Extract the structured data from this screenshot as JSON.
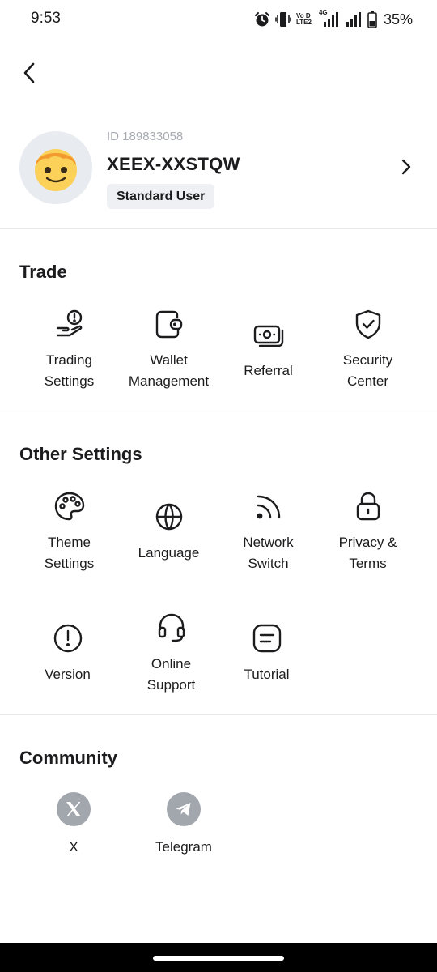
{
  "status_bar": {
    "time": "9:53",
    "battery": "35%",
    "network_tag": "4G",
    "volte_line1": "Vo D",
    "volte_line2": "LTE2",
    "icons": [
      "alarm-icon",
      "vibrate-icon",
      "volte-icon",
      "signal-icon",
      "signal-icon",
      "battery-icon"
    ]
  },
  "header": {
    "back_icon": "chevron-left-icon"
  },
  "profile": {
    "id_text": "ID 189833058",
    "name": "XEEX-XXSTQW",
    "badge": "Standard User",
    "avatar_icon": "emoji-face-avatar"
  },
  "trade": {
    "title": "Trade",
    "items": [
      {
        "label": "Trading\nSettings",
        "icon": "hand-coin-icon"
      },
      {
        "label": "Wallet\nManagement",
        "icon": "wallet-icon"
      },
      {
        "label": "Referral",
        "icon": "cash-stack-icon"
      },
      {
        "label": "Security\nCenter",
        "icon": "shield-check-icon"
      }
    ]
  },
  "other_settings": {
    "title": "Other Settings",
    "items": [
      {
        "label": "Theme\nSettings",
        "icon": "palette-icon"
      },
      {
        "label": "Language",
        "icon": "globe-icon"
      },
      {
        "label": "Network\nSwitch",
        "icon": "rss-icon"
      },
      {
        "label": "Privacy &\nTerms",
        "icon": "lock-icon"
      },
      {
        "label": "Version",
        "icon": "exclamation-circle-icon"
      },
      {
        "label": "Online\nSupport",
        "icon": "headset-icon"
      },
      {
        "label": "Tutorial",
        "icon": "document-icon"
      }
    ]
  },
  "community": {
    "title": "Community",
    "items": [
      {
        "label": "X",
        "icon": "x-logo-icon"
      },
      {
        "label": "Telegram",
        "icon": "telegram-icon"
      }
    ]
  },
  "colors": {
    "text": "#1c1c1e",
    "muted": "#a7abb1",
    "badge_bg": "#eef0f3",
    "community_icon_bg": "#a2a6ad",
    "divider": "#e7e8ea",
    "avatar_bg": "#e8ebef"
  }
}
